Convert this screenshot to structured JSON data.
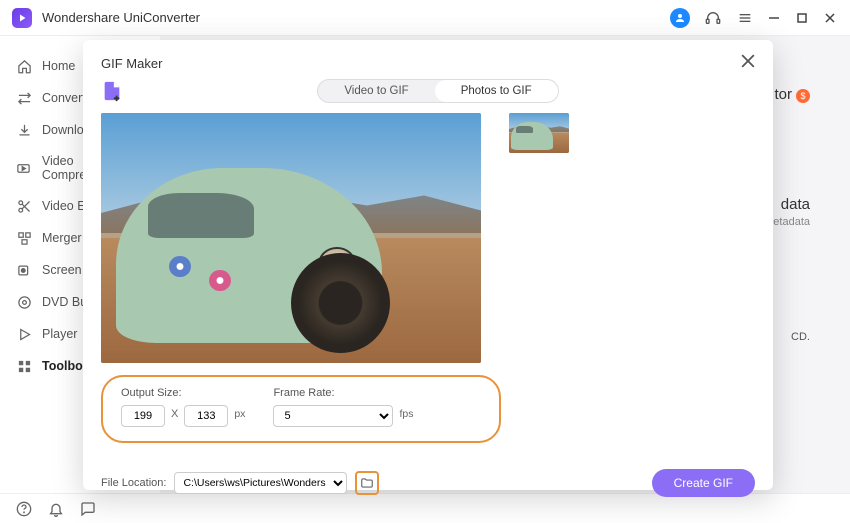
{
  "app": {
    "title": "Wondershare UniConverter"
  },
  "sidebar": {
    "items": [
      {
        "label": "Home"
      },
      {
        "label": "Converter"
      },
      {
        "label": "Downloader"
      },
      {
        "label": "Video Compressor"
      },
      {
        "label": "Video Editor"
      },
      {
        "label": "Merger"
      },
      {
        "label": "Screen Recorder"
      },
      {
        "label": "DVD Burner"
      },
      {
        "label": "Player"
      },
      {
        "label": "Toolbox"
      }
    ]
  },
  "background": {
    "editor_label": "tor",
    "badge": "$",
    "data_title": "data",
    "data_sub": "etadata",
    "cd_text": "CD."
  },
  "modal": {
    "title": "GIF Maker",
    "tabs": {
      "video": "Video to GIF",
      "photos": "Photos to GIF"
    },
    "settings": {
      "output_label": "Output Size:",
      "width": "199",
      "height": "133",
      "px": "px",
      "x": "X",
      "frame_label": "Frame Rate:",
      "fps_value": "5",
      "fps": "fps"
    },
    "file": {
      "label": "File Location:",
      "path": "C:\\Users\\ws\\Pictures\\Wonders"
    },
    "create_btn": "Create GIF"
  }
}
